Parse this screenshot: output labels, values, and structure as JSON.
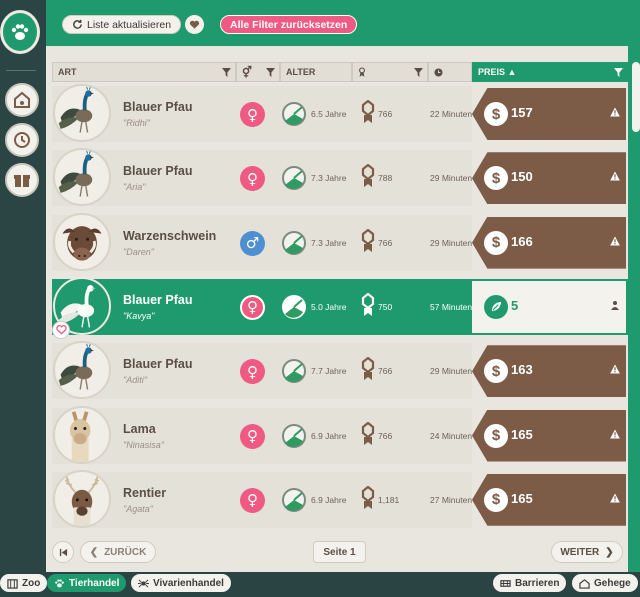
{
  "toolbar": {
    "refresh_label": "Liste aktualisieren",
    "reset_filters_label": "Alle Filter zurücksetzen"
  },
  "table": {
    "headers": {
      "species": "ART",
      "age": "ALTER",
      "price": "PREIS ▲"
    },
    "rows": [
      {
        "species": "Blauer Pfau",
        "name": "\"Ridhi\"",
        "gender": "♀",
        "age": "6.5 Jahre",
        "score": "766",
        "time": "22 Minuten",
        "price": "157",
        "currency": "$"
      },
      {
        "species": "Blauer Pfau",
        "name": "\"Aria\"",
        "gender": "♀",
        "age": "7.3 Jahre",
        "score": "788",
        "time": "29 Minuten",
        "price": "150",
        "currency": "$"
      },
      {
        "species": "Warzenschwein",
        "name": "\"Daren\"",
        "gender": "♂",
        "age": "7.3 Jahre",
        "score": "766",
        "time": "29 Minuten",
        "price": "166",
        "currency": "$"
      },
      {
        "species": "Blauer Pfau",
        "name": "\"Kavya\"",
        "gender": "♀",
        "age": "5.0 Jahre",
        "score": "750",
        "time": "57 Minuten",
        "price": "5",
        "currency": "leaf"
      },
      {
        "species": "Blauer Pfau",
        "name": "\"Aditi\"",
        "gender": "♀",
        "age": "7.7 Jahre",
        "score": "766",
        "time": "29 Minuten",
        "price": "163",
        "currency": "$"
      },
      {
        "species": "Lama",
        "name": "\"Ninasisa\"",
        "gender": "♀",
        "age": "6.9 Jahre",
        "score": "766",
        "time": "24 Minuten",
        "price": "165",
        "currency": "$"
      },
      {
        "species": "Rentier",
        "name": "\"Agata\"",
        "gender": "♀",
        "age": "6.9 Jahre",
        "score": "1,181",
        "time": "27 Minuten",
        "price": "165",
        "currency": "$"
      }
    ]
  },
  "pagination": {
    "back_label": "ZURÜCK",
    "page_label": "Seite 1",
    "next_label": "WEITER"
  },
  "bottom_tabs": {
    "zoo": "Zoo",
    "tierhandel": "Tierhandel",
    "vivarienhandel": "Vivarienhandel",
    "barrieren": "Barrieren",
    "gehege": "Gehege"
  },
  "colors": {
    "accent": "#1f9a6f",
    "price_tag": "#7c5c47",
    "female": "#ef5a82",
    "male": "#4e8fd1",
    "reset_button": "#ef5a82"
  }
}
